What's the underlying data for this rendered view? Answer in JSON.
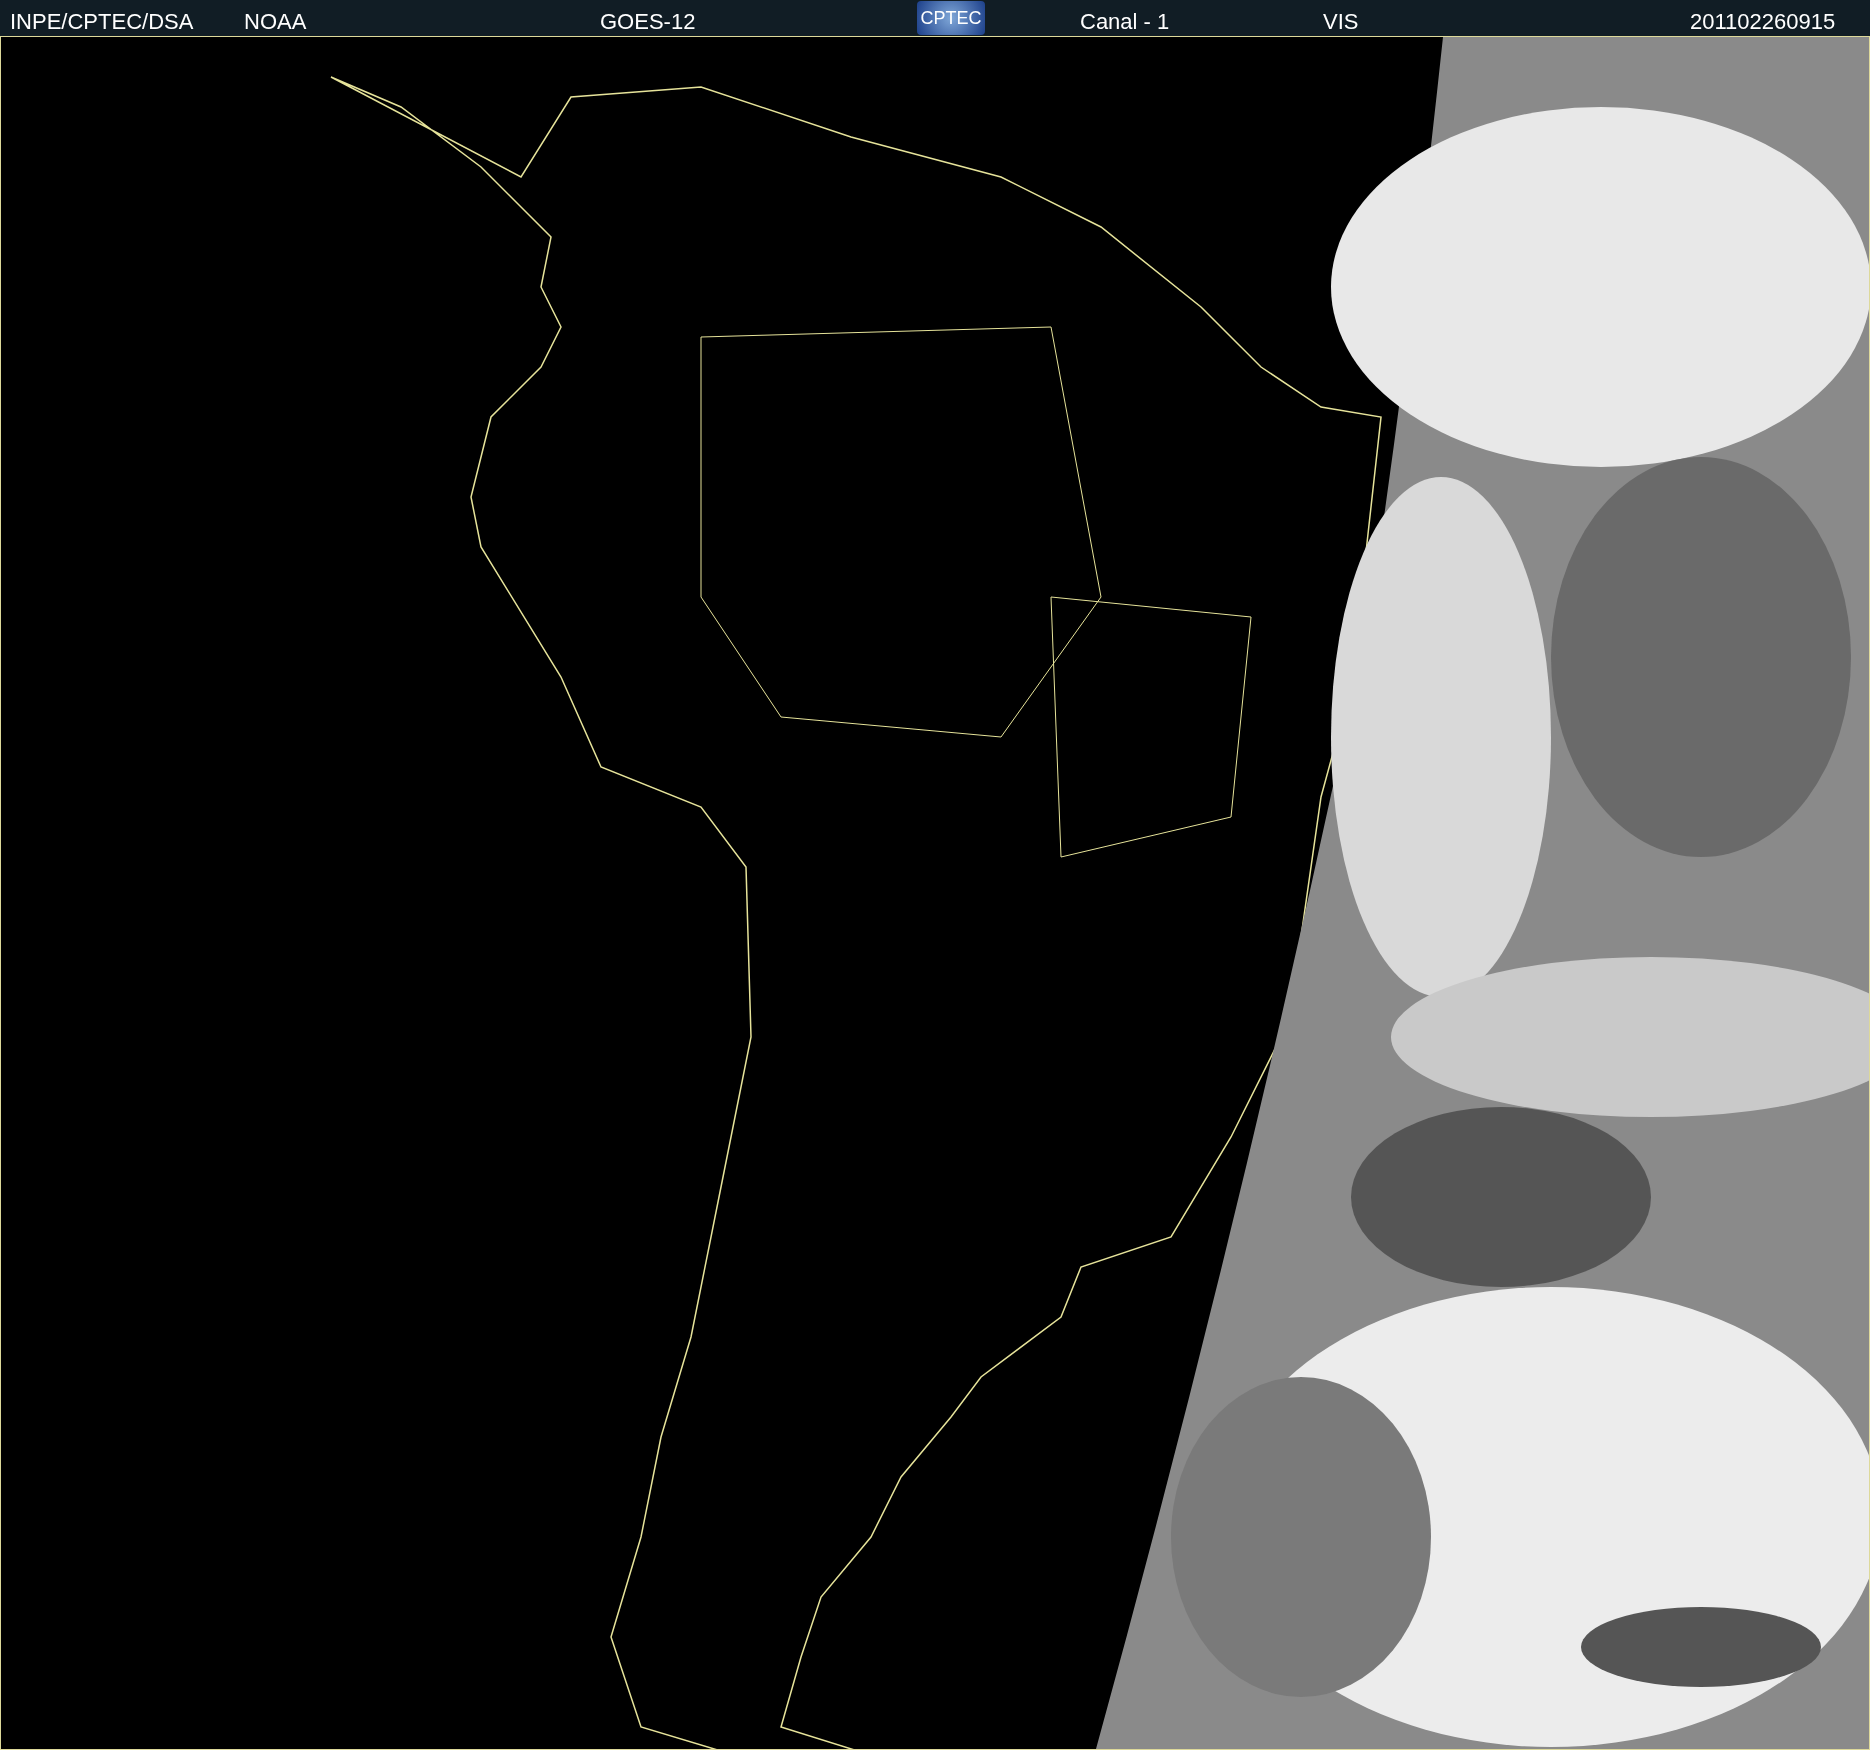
{
  "header": {
    "source": "INPE/CPTEC/DSA",
    "agency": "NOAA",
    "satellite": "GOES-12",
    "logo": "CPTEC",
    "channel": "Canal - 1",
    "band": "VIS",
    "timestamp": "201102260915"
  },
  "image": {
    "kind": "map-picture"
  }
}
